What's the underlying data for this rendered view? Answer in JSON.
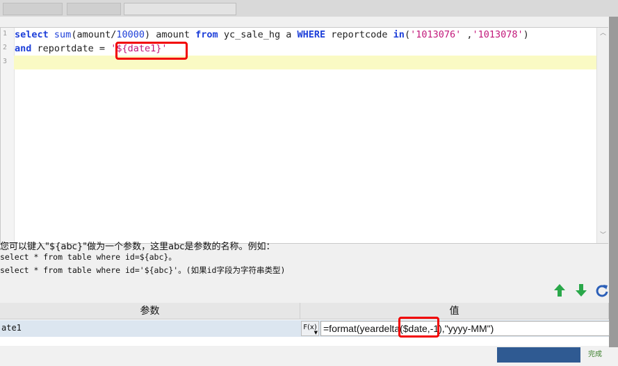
{
  "editor": {
    "line_numbers": [
      "1",
      "2",
      "3"
    ],
    "line1": {
      "kw_select": "select",
      "fn_sum": "sum",
      "open_paren": "(",
      "amount": "amount",
      "slash": "/",
      "num_divisor": "10000",
      "rest": ") amount ",
      "kw_from": "from",
      "table": " yc_sale_hg a ",
      "kw_where": "WHERE",
      "col": " reportcode ",
      "kw_in": "in",
      "paren_open": "(",
      "str1": "'1013076'",
      "comma": " ,",
      "str2": "'1013078'",
      "paren_close": ")"
    },
    "line2": {
      "kw_and": "and",
      "col": " reportdate = ",
      "str_param": "'${date1}'"
    }
  },
  "hint": {
    "line1": "您可以键入\"${abc}\"做为一个参数，这里abc是参数的名称。例如：",
    "line2": "select * from table where id=${abc}。",
    "line3": "select * from table where id='${abc}'。(如果id字段为字符串类型)"
  },
  "toolbar": {
    "up_icon": "arrow-up-icon",
    "down_icon": "arrow-down-icon",
    "refresh_icon": "refresh-icon",
    "up_color": "#2aa84a",
    "down_color": "#2aa84a",
    "refresh_color": "#2b5fb8"
  },
  "params_table": {
    "headers": [
      "参数",
      "值"
    ],
    "rows": [
      {
        "name": "ate1",
        "fx_label": "F(x)",
        "value": "=format(yeardelta($date,-1),\"yyyy-MM\")"
      }
    ]
  },
  "background": {
    "status_text": "完成"
  },
  "colors": {
    "highlight_box": "#f20000",
    "keyword": "#1d3fd9",
    "string": "#c2187a",
    "current_line": "#fafac4",
    "row_selected": "#dce6f0"
  }
}
